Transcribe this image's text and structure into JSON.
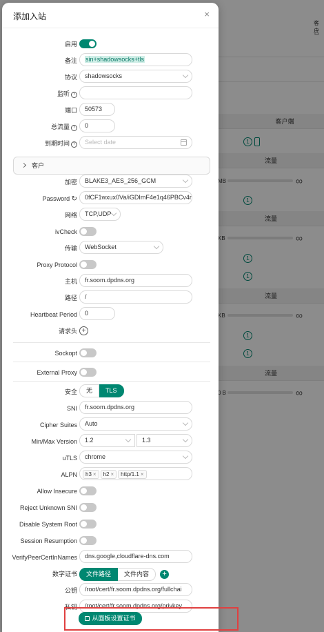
{
  "modal": {
    "title": "添加入站",
    "close": "×"
  },
  "fields": {
    "enable_label": "启用",
    "remark_label": "备注",
    "remark_value": "sin+shadowsocks+tls",
    "protocol_label": "协议",
    "protocol_value": "shadowsocks",
    "listen_label": "监听",
    "listen_value": "",
    "port_label": "端口",
    "port_value": "50573",
    "total_flow_label": "总流量",
    "total_flow_value": "0",
    "expire_label": "到期时间",
    "expire_placeholder": "Select date",
    "clients_label": "客户",
    "encryption_label": "加密",
    "encryption_value": "BLAKE3_AES_256_GCM",
    "password_label": "Password",
    "password_value": "0fCF1wxux0Va/iGDImF4e1q46PBCv4r",
    "network_label": "网络",
    "network_value": "TCP,UDP",
    "ivcheck_label": "ivCheck",
    "transport_label": "传输",
    "transport_value": "WebSocket",
    "proxy_protocol_label": "Proxy Protocol",
    "host_label": "主机",
    "host_value": "fr.soom.dpdns.org",
    "path_label": "路径",
    "path_value": "/",
    "heartbeat_label": "Heartbeat Period",
    "heartbeat_value": "0",
    "headers_label": "请求头",
    "sockopt_label": "Sockopt",
    "external_proxy_label": "External Proxy",
    "security_label": "安全",
    "security_none": "无",
    "security_tls": "TLS",
    "sni_label": "SNI",
    "sni_value": "fr.soom.dpdns.org",
    "cipher_label": "Cipher Suites",
    "cipher_value": "Auto",
    "minmax_label": "Min/Max Version",
    "min_version": "1.2",
    "max_version": "1.3",
    "utls_label": "uTLS",
    "utls_value": "chrome",
    "alpn_label": "ALPN",
    "alpn_tags": [
      "h3",
      "h2",
      "http/1.1"
    ],
    "allow_insecure_label": "Allow Insecure",
    "reject_sni_label": "Reject Unknown SNI",
    "disable_root_label": "Disable System Root",
    "session_resumption_label": "Session Resumption",
    "verify_names_label": "VerifyPeerCertInNames",
    "verify_names_value": "dns.google,cloudflare-dns.com",
    "cert_label": "数字证书",
    "cert_path_tab": "文件路径",
    "cert_content_tab": "文件内容",
    "pubkey_label": "公钥",
    "pubkey_value": "/root/cert/fr.soom.dpdns.org/fullchai",
    "privkey_label": "私钥",
    "privkey_value": "/root/cert/fr.soom.dpdns.org/privkey.",
    "cert_from_panel_button": "从面板设置证书"
  },
  "background": {
    "client_header": "客户端",
    "traffic_header": "流量",
    "client_count": "1",
    "traffic_prefix_1": "MB",
    "traffic_prefix_2": "KB",
    "traffic_prefix_3": "KB",
    "traffic_prefix_4": "0 B",
    "infinity": "∞",
    "top_right_label": "客户"
  },
  "colors": {
    "accent": "#008771",
    "highlight": "#e04040"
  }
}
